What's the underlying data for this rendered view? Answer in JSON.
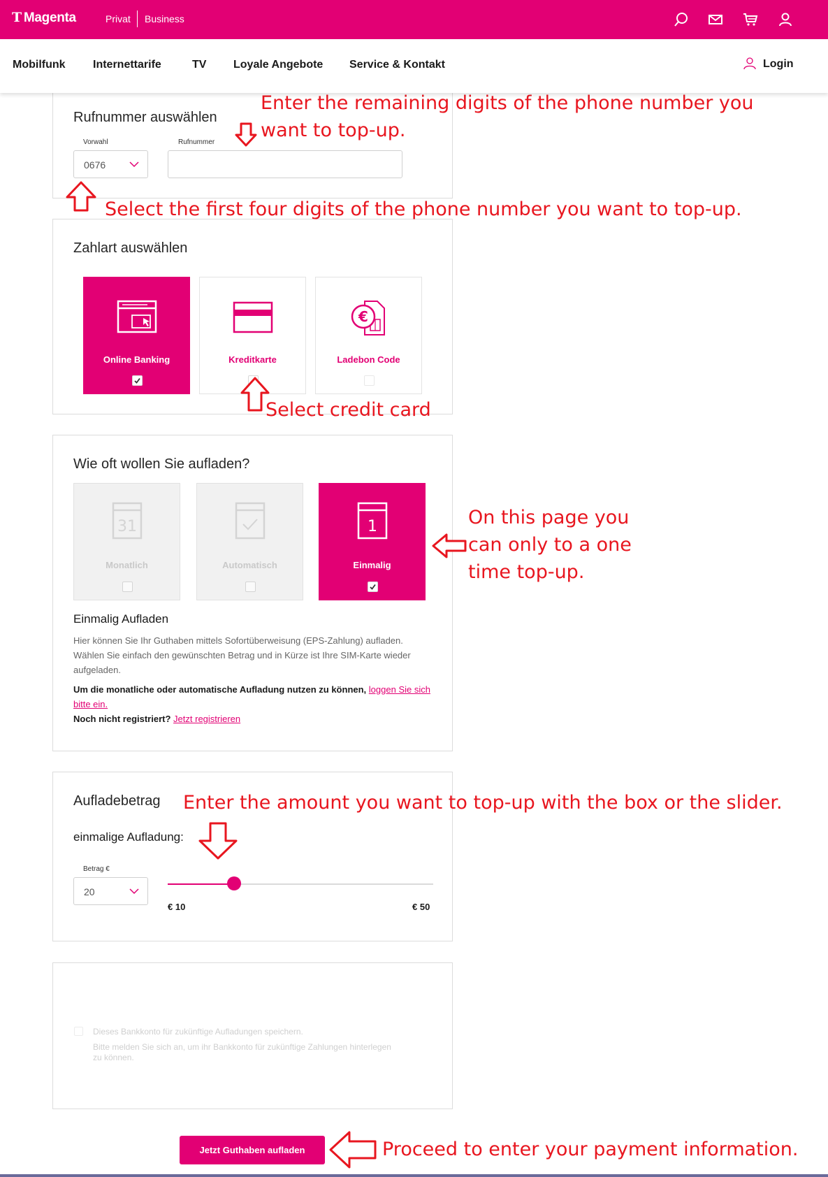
{
  "colors": {
    "brand": "#e20074",
    "annotation": "#e8161f"
  },
  "header": {
    "brand": "Magenta",
    "segments": [
      "Privat",
      "Business"
    ],
    "icons": [
      "search-icon",
      "mail-icon",
      "cart-icon",
      "user-icon"
    ]
  },
  "nav": {
    "items": [
      "Mobilfunk",
      "Internettarife",
      "TV",
      "Loyale Angebote",
      "Service & Kontakt"
    ],
    "login": "Login"
  },
  "phone": {
    "title": "Rufnummer auswählen",
    "prefix_label": "Vorwahl",
    "prefix_value": "0676",
    "number_label": "Rufnummer",
    "number_value": ""
  },
  "payment": {
    "title": "Zahlart auswählen",
    "options": [
      {
        "label": "Online Banking",
        "icon": "browser-click-icon",
        "selected": true
      },
      {
        "label": "Kreditkarte",
        "icon": "credit-card-icon",
        "selected": false
      },
      {
        "label": "Ladebon Code",
        "icon": "euro-voucher-icon",
        "selected": false
      }
    ]
  },
  "frequency": {
    "title": "Wie oft wollen Sie aufladen?",
    "options": [
      {
        "label": "Monatlich",
        "icon": "calendar-31-icon",
        "state": "disabled",
        "icon_text": "31"
      },
      {
        "label": "Automatisch",
        "icon": "calendar-check-icon",
        "state": "disabled"
      },
      {
        "label": "Einmalig",
        "icon": "calendar-1-icon",
        "state": "selected",
        "icon_text": "1"
      }
    ],
    "subtitle": "Einmalig Aufladen",
    "description": "Hier können Sie Ihr Guthaben mittels Sofortüberweisung (EPS-Zahlung) aufladen. Wählen Sie einfach den gewünschten Betrag und in Kürze ist Ihre SIM-Karte wieder aufgeladen.",
    "login_note": "Um die monatliche oder automatische Aufladung nutzen zu können,",
    "login_link": "loggen Sie sich bitte ein.",
    "register_note": "Noch nicht registriert?",
    "register_link": "Jetzt registrieren"
  },
  "amount": {
    "title": "Aufladebetrag",
    "subtitle": "einmalige Aufladung:",
    "label": "Betrag €",
    "value": "20",
    "min_label": "€ 10",
    "max_label": "€ 50",
    "slider": {
      "min": 10,
      "max": 50,
      "value": 20
    }
  },
  "save_bank": {
    "checkbox_label": "Dieses Bankkonto für zukünftige Aufladungen speichern.",
    "note": "Bitte melden Sie sich an, um ihr Bankkonto für zukünftige Zahlungen hinterlegen zu können."
  },
  "cta": {
    "label": "Jetzt Guthaben aufladen"
  },
  "annotations": {
    "remaining_digits": [
      "Enter the remaining digits of the phone number you",
      "want to top-up."
    ],
    "first_digits": "Select the first four digits of the phone number you want to top-up.",
    "credit_card": "Select credit card",
    "one_time": [
      "On this page you",
      "can only to a one",
      "time top-up."
    ],
    "amount": "Enter the amount you want to top-up with the box or the slider.",
    "proceed": "Proceed to enter your payment information."
  }
}
